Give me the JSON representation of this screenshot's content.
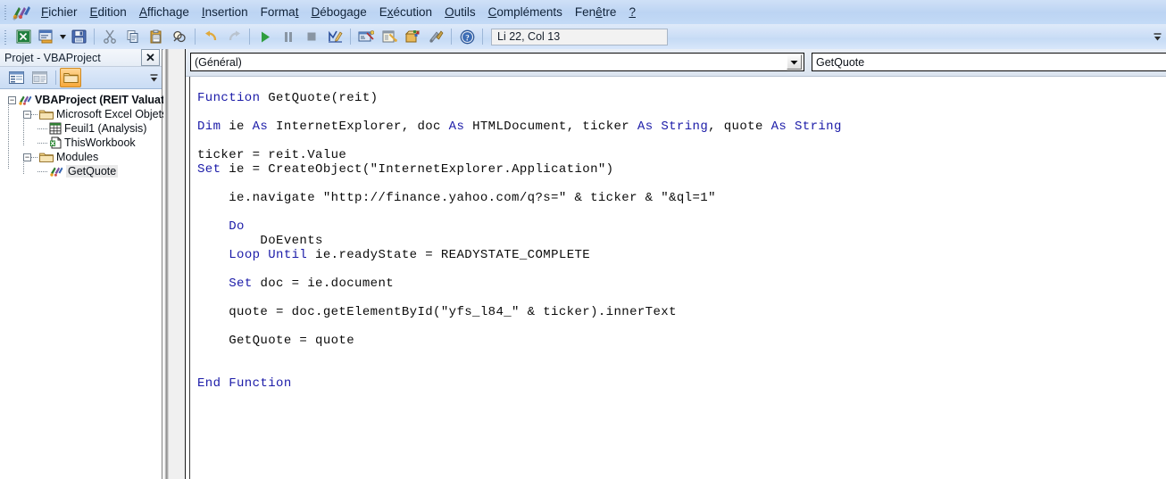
{
  "window": {
    "app_icon": "vba-logo-icon"
  },
  "menu": {
    "items": [
      {
        "label": "Fichier",
        "accel": "F"
      },
      {
        "label": "Edition",
        "accel": "E"
      },
      {
        "label": "Affichage",
        "accel": "A"
      },
      {
        "label": "Insertion",
        "accel": "I"
      },
      {
        "label": "Format",
        "accel": "t"
      },
      {
        "label": "Débogage",
        "accel": "D"
      },
      {
        "label": "Exécution",
        "accel": "x"
      },
      {
        "label": "Outils",
        "accel": "O"
      },
      {
        "label": "Compléments",
        "accel": "C"
      },
      {
        "label": "Fenêtre",
        "accel": "ê"
      },
      {
        "label": "?",
        "accel": "?"
      }
    ]
  },
  "toolbar": {
    "buttons": [
      {
        "name": "view-excel-icon",
        "title": "Afficher Microsoft Excel"
      },
      {
        "name": "insert-userform-icon",
        "title": "Insérer UserForm"
      },
      {
        "name": "save-icon",
        "title": "Enregistrer"
      },
      {
        "name": "cut-icon",
        "title": "Couper"
      },
      {
        "name": "copy-icon",
        "title": "Copier"
      },
      {
        "name": "paste-icon",
        "title": "Coller"
      },
      {
        "name": "find-icon",
        "title": "Rechercher"
      },
      {
        "name": "undo-icon",
        "title": "Annuler"
      },
      {
        "name": "redo-icon",
        "title": "Rétablir"
      },
      {
        "name": "run-icon",
        "title": "Exécuter Sub/UserForm"
      },
      {
        "name": "pause-icon",
        "title": "Interrompre"
      },
      {
        "name": "stop-icon",
        "title": "Réinitialiser"
      },
      {
        "name": "design-mode-icon",
        "title": "Mode création"
      },
      {
        "name": "project-explorer-icon",
        "title": "Explorateur de projet"
      },
      {
        "name": "properties-window-icon",
        "title": "Fenêtre Propriétés"
      },
      {
        "name": "object-browser-icon",
        "title": "Explorateur d'objets"
      },
      {
        "name": "toolbox-icon",
        "title": "Boîte à outils"
      },
      {
        "name": "help-icon",
        "title": "Aide"
      }
    ],
    "status": "Li 22, Col 13"
  },
  "project_explorer": {
    "title": "Projet - VBAProject",
    "close_label": "✕",
    "toolbar_buttons": [
      {
        "name": "view-code-button",
        "title": "Afficher code"
      },
      {
        "name": "view-object-button",
        "title": "Afficher objet"
      },
      {
        "name": "toggle-folders-button",
        "title": "Dossiers"
      }
    ],
    "tree": {
      "root": {
        "label": "VBAProject (REIT Valuat",
        "icon": "vba-project-icon"
      },
      "excel_objects": {
        "label": "Microsoft Excel Objets",
        "icon": "folder-icon"
      },
      "sheet1": {
        "label": "Feuil1 (Analysis)",
        "icon": "worksheet-icon"
      },
      "thisworkbook": {
        "label": "ThisWorkbook",
        "icon": "workbook-icon"
      },
      "modules_folder": {
        "label": "Modules",
        "icon": "folder-icon"
      },
      "module_getquote": {
        "label": "GetQuote",
        "icon": "module-icon"
      }
    }
  },
  "code_window": {
    "object_combo": {
      "value": "(Général)"
    },
    "procedure_combo": {
      "value": "GetQuote"
    },
    "code_lines": [
      [
        {
          "t": "",
          "k": false
        }
      ],
      [
        {
          "t": "Function ",
          "k": true
        },
        {
          "t": "GetQuote(reit)",
          "k": false
        }
      ],
      [
        {
          "t": "",
          "k": false
        }
      ],
      [
        {
          "t": "Dim ",
          "k": true
        },
        {
          "t": "ie ",
          "k": false
        },
        {
          "t": "As ",
          "k": true
        },
        {
          "t": "InternetExplorer, doc ",
          "k": false
        },
        {
          "t": "As ",
          "k": true
        },
        {
          "t": "HTMLDocument, ticker ",
          "k": false
        },
        {
          "t": "As ",
          "k": true
        },
        {
          "t": "String",
          "k": true
        },
        {
          "t": ", quote ",
          "k": false
        },
        {
          "t": "As ",
          "k": true
        },
        {
          "t": "String",
          "k": true
        }
      ],
      [
        {
          "t": "",
          "k": false
        }
      ],
      [
        {
          "t": "ticker = reit.Value",
          "k": false
        }
      ],
      [
        {
          "t": "Set ",
          "k": true
        },
        {
          "t": "ie = CreateObject(\"InternetExplorer.Application\")",
          "k": false
        }
      ],
      [
        {
          "t": "",
          "k": false
        }
      ],
      [
        {
          "t": "    ie.navigate \"http://finance.yahoo.com/q?s=\" & ticker & \"&ql=1\"",
          "k": false
        }
      ],
      [
        {
          "t": "",
          "k": false
        }
      ],
      [
        {
          "t": "    ",
          "k": false
        },
        {
          "t": "Do",
          "k": true
        }
      ],
      [
        {
          "t": "        DoEvents",
          "k": false
        }
      ],
      [
        {
          "t": "    ",
          "k": false
        },
        {
          "t": "Loop Until ",
          "k": true
        },
        {
          "t": "ie.readyState = READYSTATE_COMPLETE",
          "k": false
        }
      ],
      [
        {
          "t": "",
          "k": false
        }
      ],
      [
        {
          "t": "    ",
          "k": false
        },
        {
          "t": "Set ",
          "k": true
        },
        {
          "t": "doc = ie.document",
          "k": false
        }
      ],
      [
        {
          "t": "",
          "k": false
        }
      ],
      [
        {
          "t": "    quote = doc.getElementById(\"yfs_l84_\" & ticker).innerText",
          "k": false
        }
      ],
      [
        {
          "t": "",
          "k": false
        }
      ],
      [
        {
          "t": "    GetQuote = quote",
          "k": false
        }
      ],
      [
        {
          "t": "",
          "k": false
        }
      ],
      [
        {
          "t": "",
          "k": false
        }
      ],
      [
        {
          "t": "End Function",
          "k": true
        }
      ]
    ]
  },
  "colors": {
    "menubar": "#bfd8f5",
    "keyword": "#1b1ba8",
    "accent_orange": "#f7a93c",
    "selection": "#e9e9e9"
  }
}
